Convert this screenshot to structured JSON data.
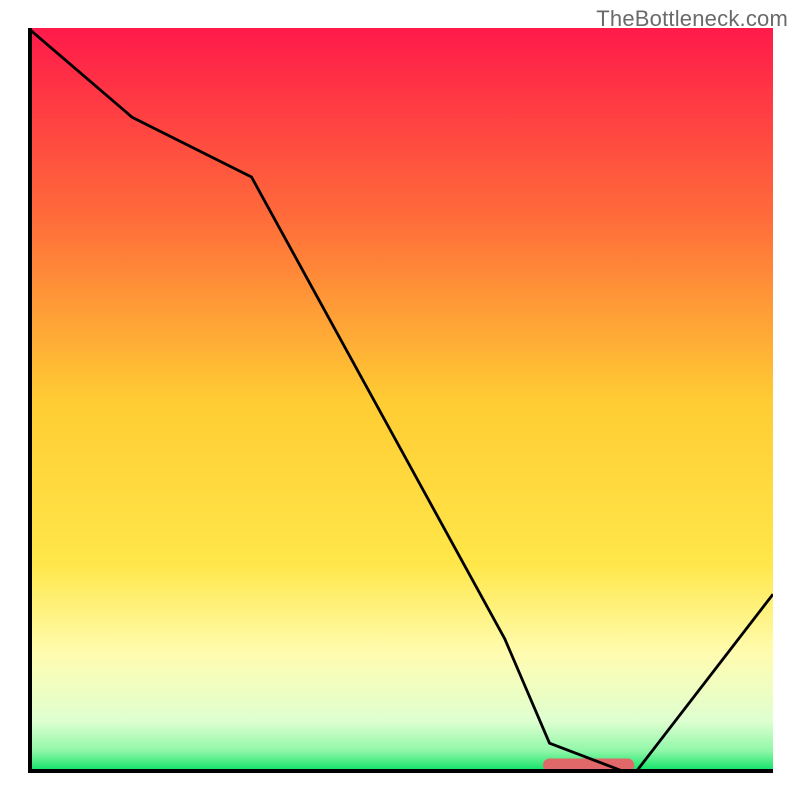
{
  "watermark": "TheBottleneck.com",
  "chart_data": {
    "type": "line",
    "title": "",
    "xlabel": "",
    "ylabel": "",
    "xlim": [
      0,
      100
    ],
    "ylim": [
      0,
      100
    ],
    "grid": false,
    "x": [
      0,
      14,
      30,
      64,
      70,
      80.5,
      81.5,
      100
    ],
    "values": [
      100,
      88,
      80,
      18,
      4,
      0,
      0,
      24
    ],
    "marker": {
      "x_start": 70,
      "x_end": 80.5,
      "y": 0
    },
    "background_gradient_stops": [
      {
        "offset": 0.0,
        "color": "#ff1a4a"
      },
      {
        "offset": 0.25,
        "color": "#ff6a3a"
      },
      {
        "offset": 0.5,
        "color": "#ffcc33"
      },
      {
        "offset": 0.72,
        "color": "#ffe74a"
      },
      {
        "offset": 0.84,
        "color": "#fffcb0"
      },
      {
        "offset": 0.93,
        "color": "#dfffd0"
      },
      {
        "offset": 0.97,
        "color": "#90f7a8"
      },
      {
        "offset": 1.0,
        "color": "#00e060"
      }
    ],
    "axis_color": "#000000",
    "line_color": "#000000",
    "marker_color": "#e06868"
  }
}
